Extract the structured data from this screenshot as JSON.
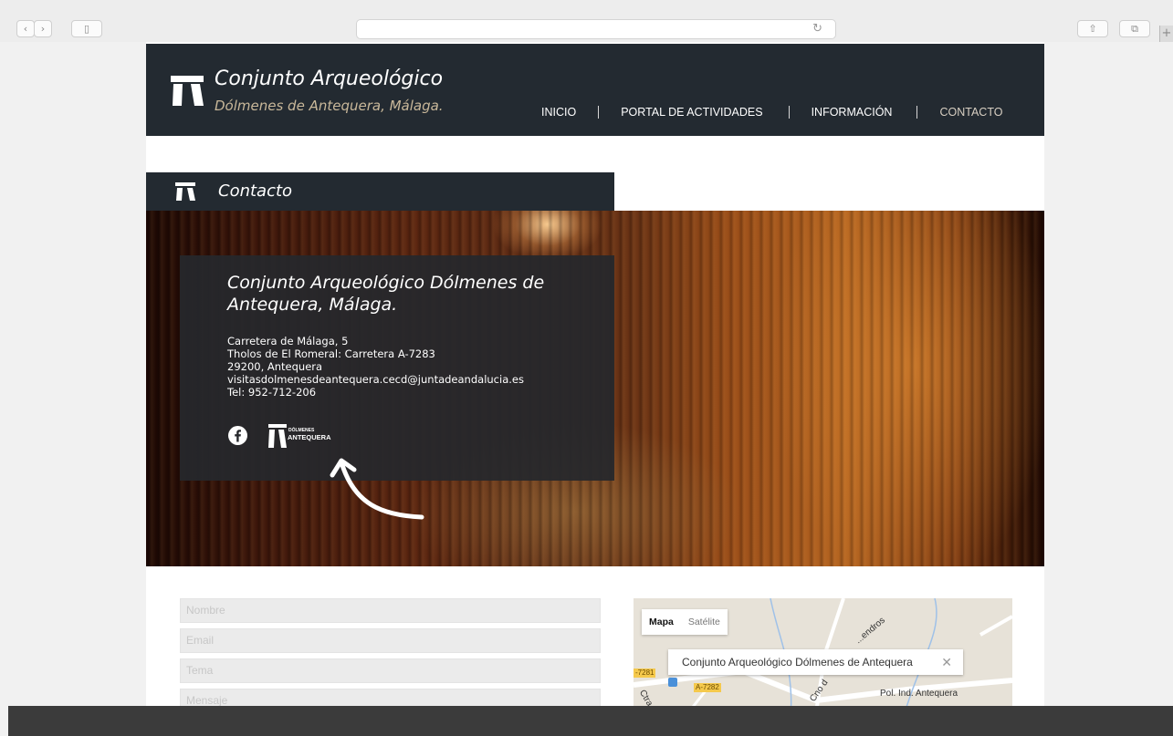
{
  "header": {
    "title": "Conjunto Arqueológico",
    "subtitle": "Dólmenes de Antequera, Málaga.",
    "nav": [
      {
        "label": "INICIO"
      },
      {
        "label": "PORTAL DE ACTIVIDADES"
      },
      {
        "label": "INFORMACIÓN"
      },
      {
        "label": "CONTACTO",
        "active": true
      }
    ]
  },
  "section": {
    "title": "Contacto"
  },
  "contact_card": {
    "title": "Conjunto Arqueológico Dólmenes de Antequera, Málaga.",
    "lines": [
      "Carretera de Málaga, 5",
      "Tholos de El Romeral: Carretera A-7283",
      "29200, Antequera",
      "visitasdolmenesdeantequera.cecd@juntadeandalucia.es",
      "Tel: 952-712-206"
    ],
    "logo_text": [
      "DÓLMENES",
      "ANTEQUERA"
    ]
  },
  "form": {
    "name_placeholder": "Nombre",
    "email_placeholder": "Email",
    "subject_placeholder": "Tema",
    "message_placeholder": "Mensaje"
  },
  "map": {
    "tabs": [
      "Mapa",
      "Satélite"
    ],
    "active_tab": "Mapa",
    "info_title": "Conjunto Arqueológico Dólmenes de Antequera",
    "roads": [
      "-7281",
      "A-7282"
    ],
    "labels": [
      "Pol. Ind. Antequera",
      "Ctra",
      "Cno d",
      "...endros"
    ]
  },
  "colors": {
    "header_bg": "#232a31",
    "accent_text": "#c9b89a"
  }
}
